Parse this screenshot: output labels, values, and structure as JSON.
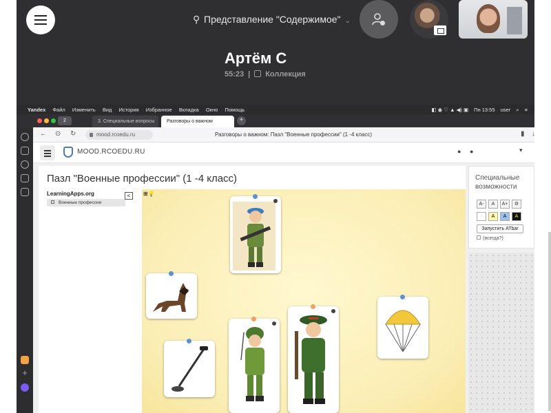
{
  "call": {
    "presentation_label": "Представление \"Содержимое\"",
    "title": "Артём С",
    "time": "55:23",
    "collection_label": "Коллекция"
  },
  "menubar": {
    "app": "Yandex",
    "items": [
      "Файл",
      "Изменить",
      "Вид",
      "История",
      "Избранное",
      "Вкладка",
      "Окно",
      "Помощь"
    ],
    "clock": "Пн 13:55",
    "user": "user"
  },
  "browser": {
    "tab_count": "2",
    "tabs": [
      {
        "label": "3. Специальные вопросы"
      },
      {
        "label": "Разговоры о важном"
      }
    ],
    "url": "mood.rcoedu.ru",
    "page_title": "Разговоры о важном: Пазл \"Военные профессии\" (1 -4 класс)"
  },
  "site": {
    "name": "MOOD.RCOEDU.RU"
  },
  "page": {
    "title": "Пазл \"Военные профессии\" (1 -4 класс)",
    "learningapps_brand": "LearningApps.org",
    "app_item": "Военные профессии",
    "collapse_glyph": "<"
  },
  "puzzle": {
    "cards": [
      {
        "name": "soldier-blue-beret-card",
        "pin_color": "#5b8fd8"
      },
      {
        "name": "dog-card",
        "pin_color": "#5b8fd8"
      },
      {
        "name": "metal-detector-card",
        "pin_color": "#5b8fd8"
      },
      {
        "name": "soldier-green-helmet-card",
        "pin_color": "#f0a060"
      },
      {
        "name": "officer-card",
        "pin_color": "#f0a060"
      },
      {
        "name": "parachute-card",
        "pin_color": "#5b8fd8"
      }
    ]
  },
  "accessibility": {
    "title": "Специальные возможности",
    "size_buttons": [
      "A-",
      "A",
      "A+"
    ],
    "theme_buttons": [
      "A",
      "A",
      "A"
    ],
    "run_button": "Запустить ATbar",
    "always_label": "(всегда?)"
  },
  "colors": {
    "call_bg": "#2f2f31",
    "puzzle_bg": "#fbeeb5",
    "site_logo": "#4a7bb7"
  }
}
